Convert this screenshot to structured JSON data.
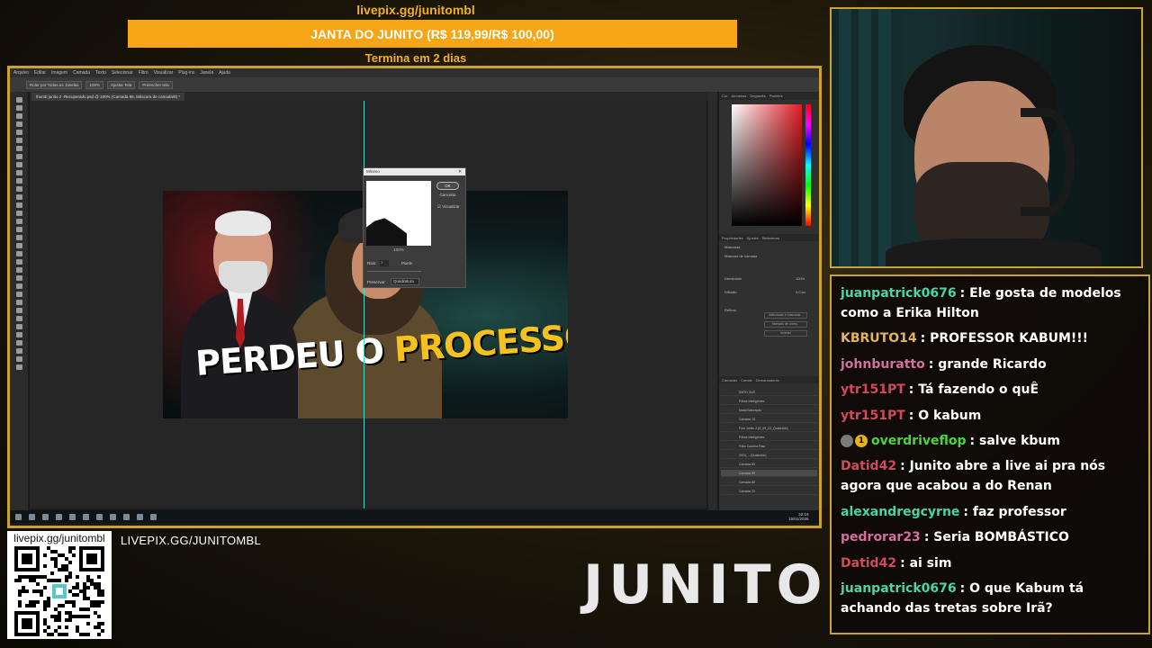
{
  "donation": {
    "url": "livepix.gg/junitombl",
    "goal_text": "JANTA DO JUNITO (R$ 119,99/R$ 100,00)",
    "goal_progress": 1.0,
    "ends_text": "Termina em 2 dias"
  },
  "photoshop": {
    "menu": [
      "Arquivo",
      "Editar",
      "Imagem",
      "Camada",
      "Texto",
      "Selecionar",
      "Filtro",
      "Visualizar",
      "Plug-ins",
      "Janela",
      "Ajuda"
    ],
    "options": [
      "Rolar por Todas as Janelas",
      "100%",
      "Ajustar Tela",
      "Preencher tela"
    ],
    "doc_tab": "thumb junito 2 -Recuperado.psd @ 100% (Camada 95, Máscara de camada/8) *",
    "thumbnail": {
      "headline_white": "PERDEU O ",
      "headline_yellow": "PROCESSO"
    },
    "dialog": {
      "title": "Mínimo",
      "ok": "OK",
      "cancel": "Cancelar",
      "preview": "Visualizar",
      "zoom": "100%",
      "radius_label": "Raio:",
      "radius_value": "1",
      "unit": "Pixels",
      "preserve_label": "Preservar:",
      "preserve_value": "Quadratura"
    },
    "panels": {
      "color_tabs": [
        "Cor",
        "Amostras",
        "Degradês",
        "Padrões"
      ],
      "props_tabs": [
        "Propriedades",
        "Ajustes",
        "Bibliotecas"
      ],
      "props_items": [
        "Máscaras",
        "Máscara de camada",
        "Densidade",
        "Difusão",
        "Refinar"
      ],
      "props_values": [
        "100%",
        "0,0 px"
      ],
      "props_buttons": [
        "Selecionar e mascarar...",
        "Intervalo de cores...",
        "Inverter"
      ],
      "layers_tabs": [
        "Camadas",
        "Canais",
        "Demarcadores"
      ],
      "layers": [
        "SMTH ZUD",
        "Filtros Inteligentes",
        "Matiz/Saturação",
        "Camada 18",
        "Foto Junito 2 (8_09_23_Quadrado)",
        "Filtros Inteligentes",
        "Filtro Camera Raw",
        "2024_...(Quadrado)",
        "Camada 83",
        "Camada 95",
        "Camada 88",
        "Camada 22"
      ],
      "colors": {
        "accent": "#e01c24"
      }
    },
    "taskbar": {
      "time": "22:19",
      "date": "15/01/2026"
    },
    "status": "100%"
  },
  "chat": {
    "messages": [
      {
        "user": "juanpatrick0676",
        "color": "#47d6a6",
        "text": "Ele gosta de modelos como a Erika Hilton",
        "badges": []
      },
      {
        "user": "KBRUTO14",
        "color": "#e6b35c",
        "text": "PROFESSOR KABUM!!!",
        "badges": []
      },
      {
        "user": "johnburatto",
        "color": "#d46fa0",
        "text": "grande Ricardo",
        "badges": []
      },
      {
        "user": "ytr151PT",
        "color": "#d24a5a",
        "text": "Tá fazendo o quÊ",
        "badges": []
      },
      {
        "user": "ytr151PT",
        "color": "#d24a5a",
        "text": "O kabum",
        "badges": []
      },
      {
        "user": "overdriveflop",
        "color": "#49d63b",
        "text": "salve kbum",
        "badges": [
          "avatar",
          "1"
        ]
      },
      {
        "user": "Datid42",
        "color": "#d24a5a",
        "text": "Junito abre a live ai pra nós agora que acabou a do Renan",
        "badges": []
      },
      {
        "user": "alexandregcyrne",
        "color": "#47d6a6",
        "text": "faz professor",
        "badges": []
      },
      {
        "user": "pedrorar23",
        "color": "#d46fa0",
        "text": "Seria BOMBÁSTICO",
        "badges": []
      },
      {
        "user": "Datid42",
        "color": "#d24a5a",
        "text": "ai sim",
        "badges": []
      },
      {
        "user": "juanpatrick0676",
        "color": "#47d6a6",
        "text": "O que Kabum tá achando das tretas sobre Irã?",
        "badges": []
      }
    ]
  },
  "bottom": {
    "qr_url": "livepix.gg/junitombl",
    "url": "LIVEPIX.GG/JUNITOMBL",
    "logo": "JUNITO"
  },
  "theme": {
    "gold": "#caa22f",
    "orange": "#f5a516"
  }
}
